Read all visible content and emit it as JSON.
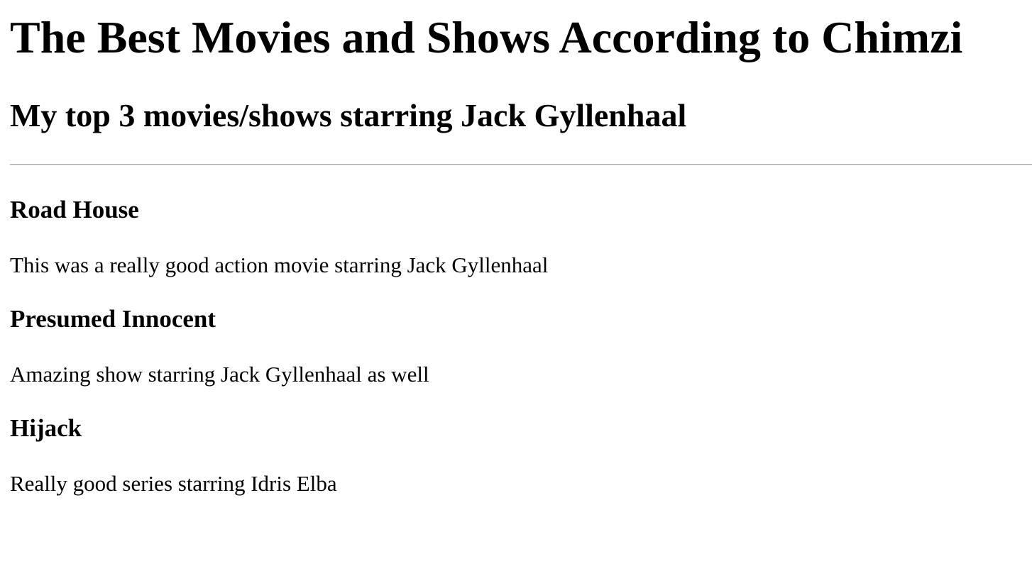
{
  "page": {
    "title": "The Best Movies and Shows According to Chimzi",
    "subtitle": "My top 3 movies/shows starring Jack Gyllenhaal"
  },
  "entries": [
    {
      "title": "Road House",
      "description": "This was a really good action movie starring Jack Gyllenhaal"
    },
    {
      "title": "Presumed Innocent",
      "description": "Amazing show starring Jack Gyllenhaal as well"
    },
    {
      "title": "Hijack",
      "description": "Really good series starring Idris Elba"
    }
  ]
}
